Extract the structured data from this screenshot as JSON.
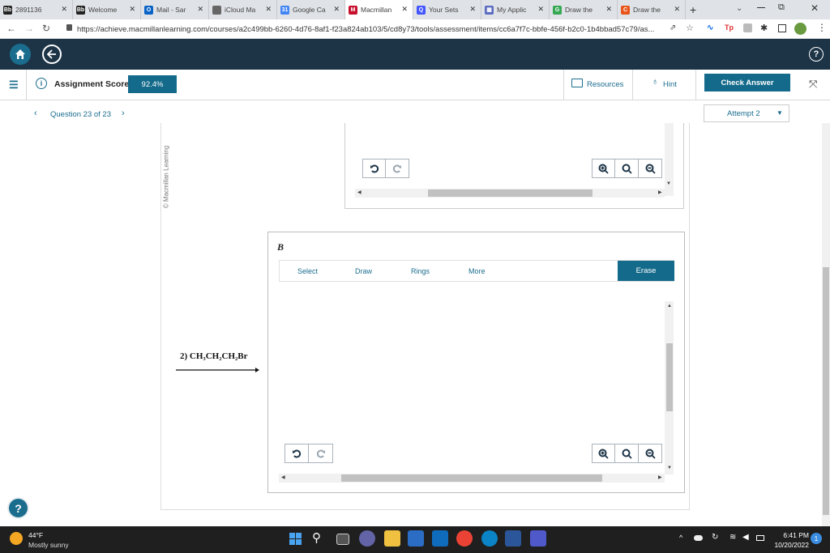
{
  "browser": {
    "tabs": [
      {
        "label": "2891136"
      },
      {
        "label": "Welcome"
      },
      {
        "label": "Mail - Sar"
      },
      {
        "label": "iCloud Ma"
      },
      {
        "label": "Google Ca"
      },
      {
        "label": "Macmillan"
      },
      {
        "label": "Your Sets"
      },
      {
        "label": "My Applic"
      },
      {
        "label": "Draw the"
      },
      {
        "label": "Draw the"
      }
    ],
    "url": "https://achieve.macmillanlearning.com/courses/a2c499bb-6260-4d76-8af1-f23a824ab103/5/cd8y73/tools/assessment/items/cc6a7f7c-bbfe-456f-b2c0-1b4bbad57c79/as..."
  },
  "toolbar": {
    "score_label": "Assignment Score:",
    "score_value": "92.4%",
    "resources": "Resources",
    "hint": "Hint",
    "check_answer": "Check Answer"
  },
  "question": {
    "nav_label": "Question 23 of 23",
    "attempt": "Attempt 2",
    "watermark": "© Macmillan Learning",
    "reagent": "2) CH₃CH₂CH₂Br",
    "panel_label": "B"
  },
  "editor": {
    "tabs": [
      "Select",
      "Draw",
      "Rings",
      "More"
    ],
    "erase": "Erase"
  },
  "taskbar": {
    "temp": "44°F",
    "weather": "Mostly sunny",
    "time": "6:41 PM",
    "date": "10/20/2022",
    "notifications": "1"
  },
  "colors": {
    "accent": "#136a8a",
    "header": "#1d3447"
  }
}
